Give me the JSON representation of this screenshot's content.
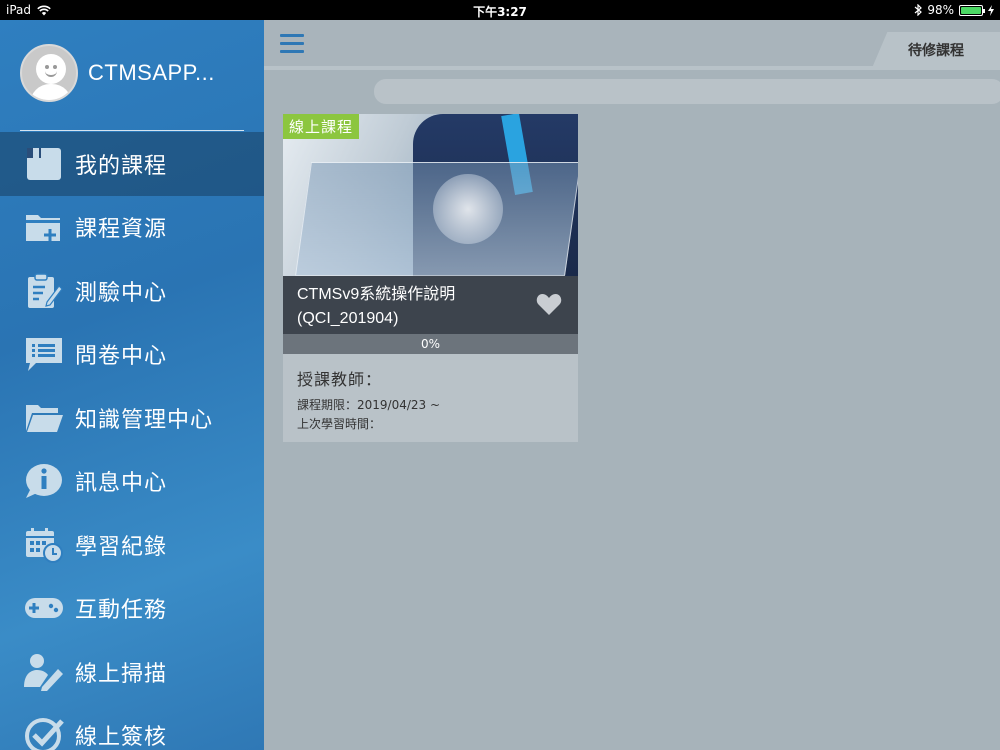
{
  "status": {
    "device": "iPad",
    "time": "下午3:27",
    "battery": "98%",
    "battery_level": 0.98
  },
  "profile": {
    "name": "CTMSAPP..."
  },
  "menu": [
    {
      "label": "我的課程",
      "icon": "book-icon",
      "active": true
    },
    {
      "label": "課程資源",
      "icon": "folder-add-icon"
    },
    {
      "label": "測驗中心",
      "icon": "clipboard-edit-icon"
    },
    {
      "label": "問卷中心",
      "icon": "list-chat-icon"
    },
    {
      "label": "知識管理中心",
      "icon": "open-folder-icon"
    },
    {
      "label": "訊息中心",
      "icon": "info-chat-icon"
    },
    {
      "label": "學習紀錄",
      "icon": "calendar-clock-icon"
    },
    {
      "label": "互動任務",
      "icon": "gamepad-icon"
    },
    {
      "label": "線上掃描",
      "icon": "user-edit-icon"
    },
    {
      "label": "線上簽核",
      "icon": "check-circle-icon"
    }
  ],
  "header": {
    "tab_label": "待修課程"
  },
  "course": {
    "badge": "線上課程",
    "title": "CTMSv9系統操作說明(QCI_201904)",
    "progress": "0%",
    "teacher_label": "授課教師：",
    "period": "課程期限：2019/04/23 ~",
    "last_study": "上次學習時間："
  },
  "colors": {
    "sidebar": "#2f7fc0",
    "accent": "#8cc63f",
    "main_bg": "#a7b3ba"
  }
}
